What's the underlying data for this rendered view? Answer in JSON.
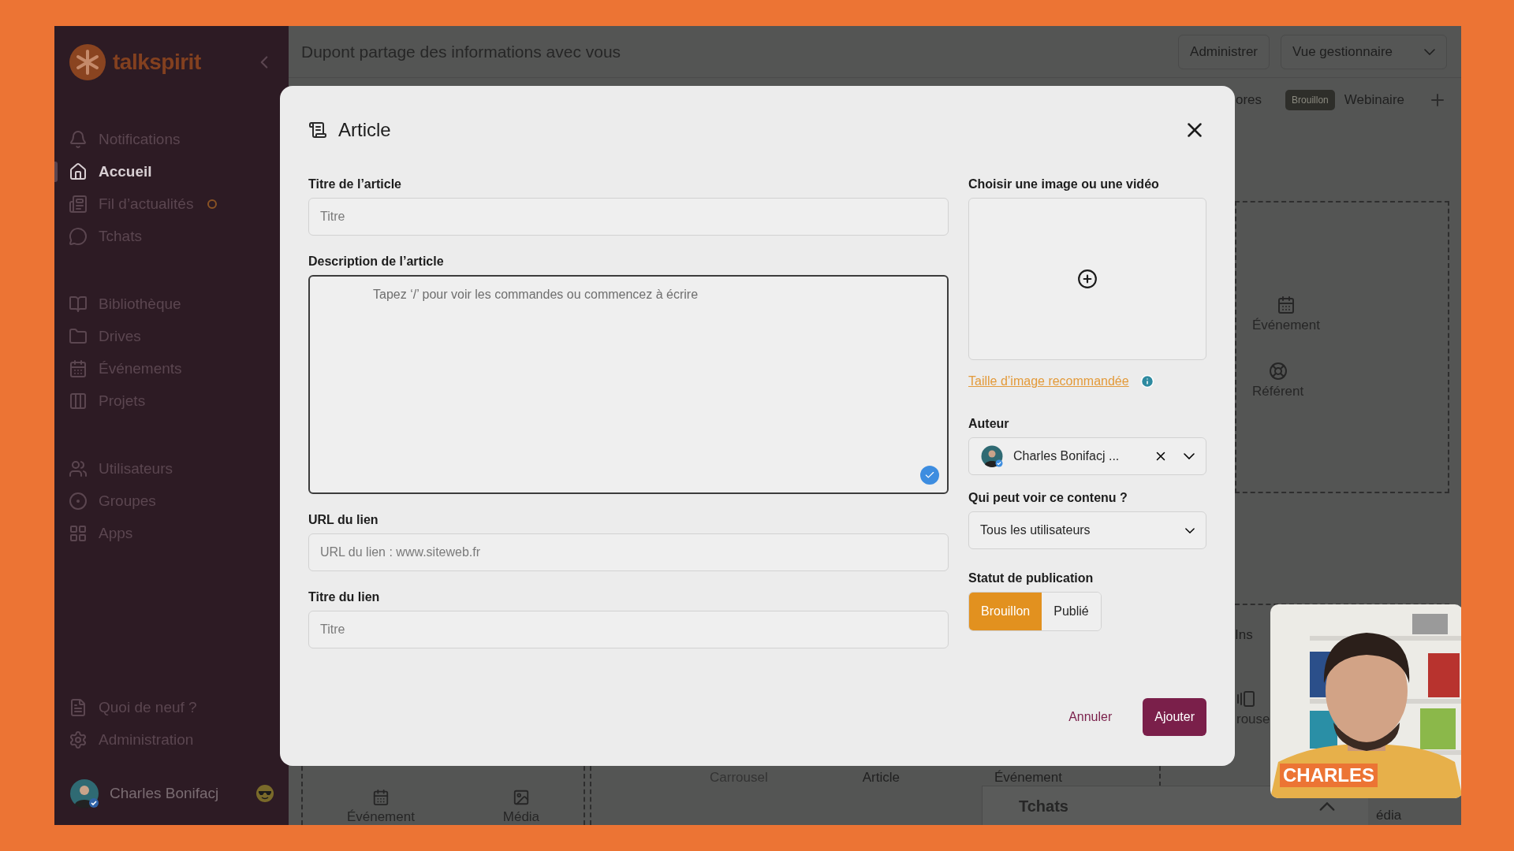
{
  "sidebar": {
    "logo": "talkspirit",
    "nav_groups": [
      [
        {
          "label": "Notifications",
          "selected": false,
          "unread": false
        },
        {
          "label": "Accueil",
          "selected": true,
          "unread": false
        },
        {
          "label": "Fil d’actualités",
          "selected": false,
          "unread": true
        },
        {
          "label": "Tchats",
          "selected": false,
          "unread": false
        }
      ],
      [
        {
          "label": "Bibliothèque",
          "selected": false,
          "unread": false
        },
        {
          "label": "Drives",
          "selected": false,
          "unread": false
        },
        {
          "label": "Événements",
          "selected": false,
          "unread": false
        },
        {
          "label": "Projets",
          "selected": false,
          "unread": false
        }
      ],
      [
        {
          "label": "Utilisateurs",
          "selected": false,
          "unread": false
        },
        {
          "label": "Groupes",
          "selected": false,
          "unread": false
        },
        {
          "label": "Apps",
          "selected": false,
          "unread": false
        }
      ]
    ],
    "footer_items": [
      {
        "label": "Quoi de neuf ?"
      },
      {
        "label": "Administration"
      }
    ],
    "user": {
      "name": "Charles Bonifacj"
    }
  },
  "header": {
    "title": "Dupont partage des informations avec vous",
    "actions": [
      {
        "label": "Administrer",
        "kind": "button"
      },
      {
        "label": "Vue gestionnaire",
        "kind": "dropdown"
      }
    ]
  },
  "tabs": [
    {
      "label": "ores"
    },
    {
      "label": "Webinaire",
      "badge": "Brouillon"
    }
  ],
  "background": {
    "right_tiles": [
      {
        "label": "Événement"
      },
      {
        "label": "Référent"
      }
    ],
    "lower_right": [
      {
        "label": "Ins"
      },
      {
        "label": "rouse"
      },
      {
        "label": "édia"
      }
    ],
    "bottom_left_tiles": [
      {
        "label": "Événement"
      },
      {
        "label": "Média"
      }
    ],
    "bottom_middle_tiles": [
      {
        "label": "Carrousel"
      },
      {
        "label": "Article"
      },
      {
        "label": "Événement"
      }
    ],
    "chat_dock": {
      "title": "Tchats"
    }
  },
  "modal": {
    "title": "Article",
    "fields": [
      {
        "label": "Titre de l’article",
        "kind": "input",
        "placeholder": "Titre"
      },
      {
        "label": "Description de l’article",
        "kind": "editor",
        "placeholder": "Tapez ‘/’ pour voir les commandes ou commencez à écrire"
      },
      {
        "label": "URL du lien",
        "kind": "input",
        "placeholder": "URL du lien : www.siteweb.fr"
      },
      {
        "label": "Titre du lien",
        "kind": "input",
        "placeholder": "Titre"
      }
    ],
    "media": {
      "label": "Choisir une image ou une vidéo",
      "link": "Taille d’image recommandée"
    },
    "author": {
      "label": "Auteur",
      "value": "Charles Bonifacj ..."
    },
    "visibility": {
      "label": "Qui peut voir ce contenu ?",
      "value": "Tous les utilisateurs"
    },
    "status": {
      "label": "Statut de publication",
      "options": [
        {
          "label": "Brouillon",
          "selected": true
        },
        {
          "label": "Publié",
          "selected": false
        }
      ]
    },
    "buttons": [
      {
        "label": "Annuler",
        "kind": "text"
      },
      {
        "label": "Ajouter",
        "kind": "primary"
      }
    ]
  },
  "webcam": {
    "caption": "CHARLES"
  }
}
